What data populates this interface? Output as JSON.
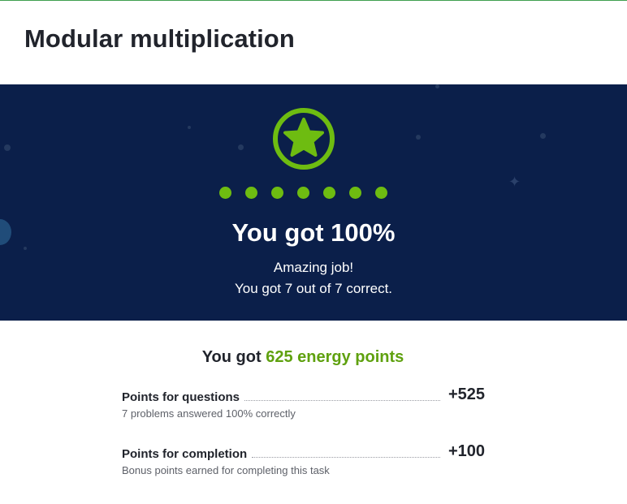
{
  "page": {
    "title": "Modular multiplication"
  },
  "result": {
    "score_text": "You got 100%",
    "praise": "Amazing job!",
    "count_text": "You got 7 out of 7 correct.",
    "correct": 7,
    "total": 7,
    "badge_icon": "star-icon"
  },
  "energy": {
    "prefix": "You got",
    "points_text": "625 energy points",
    "rows": [
      {
        "label": "Points for questions",
        "points": "+525",
        "description": "7 problems answered 100% correctly"
      },
      {
        "label": "Points for completion",
        "points": "+100",
        "description": "Bonus points earned for completing this task"
      }
    ]
  },
  "colors": {
    "hero_background": "#0b1f4a",
    "accent_green": "#6ebc11",
    "energy_green": "#5fa10f",
    "text_dark": "#21242c",
    "text_muted": "#5e6169"
  }
}
